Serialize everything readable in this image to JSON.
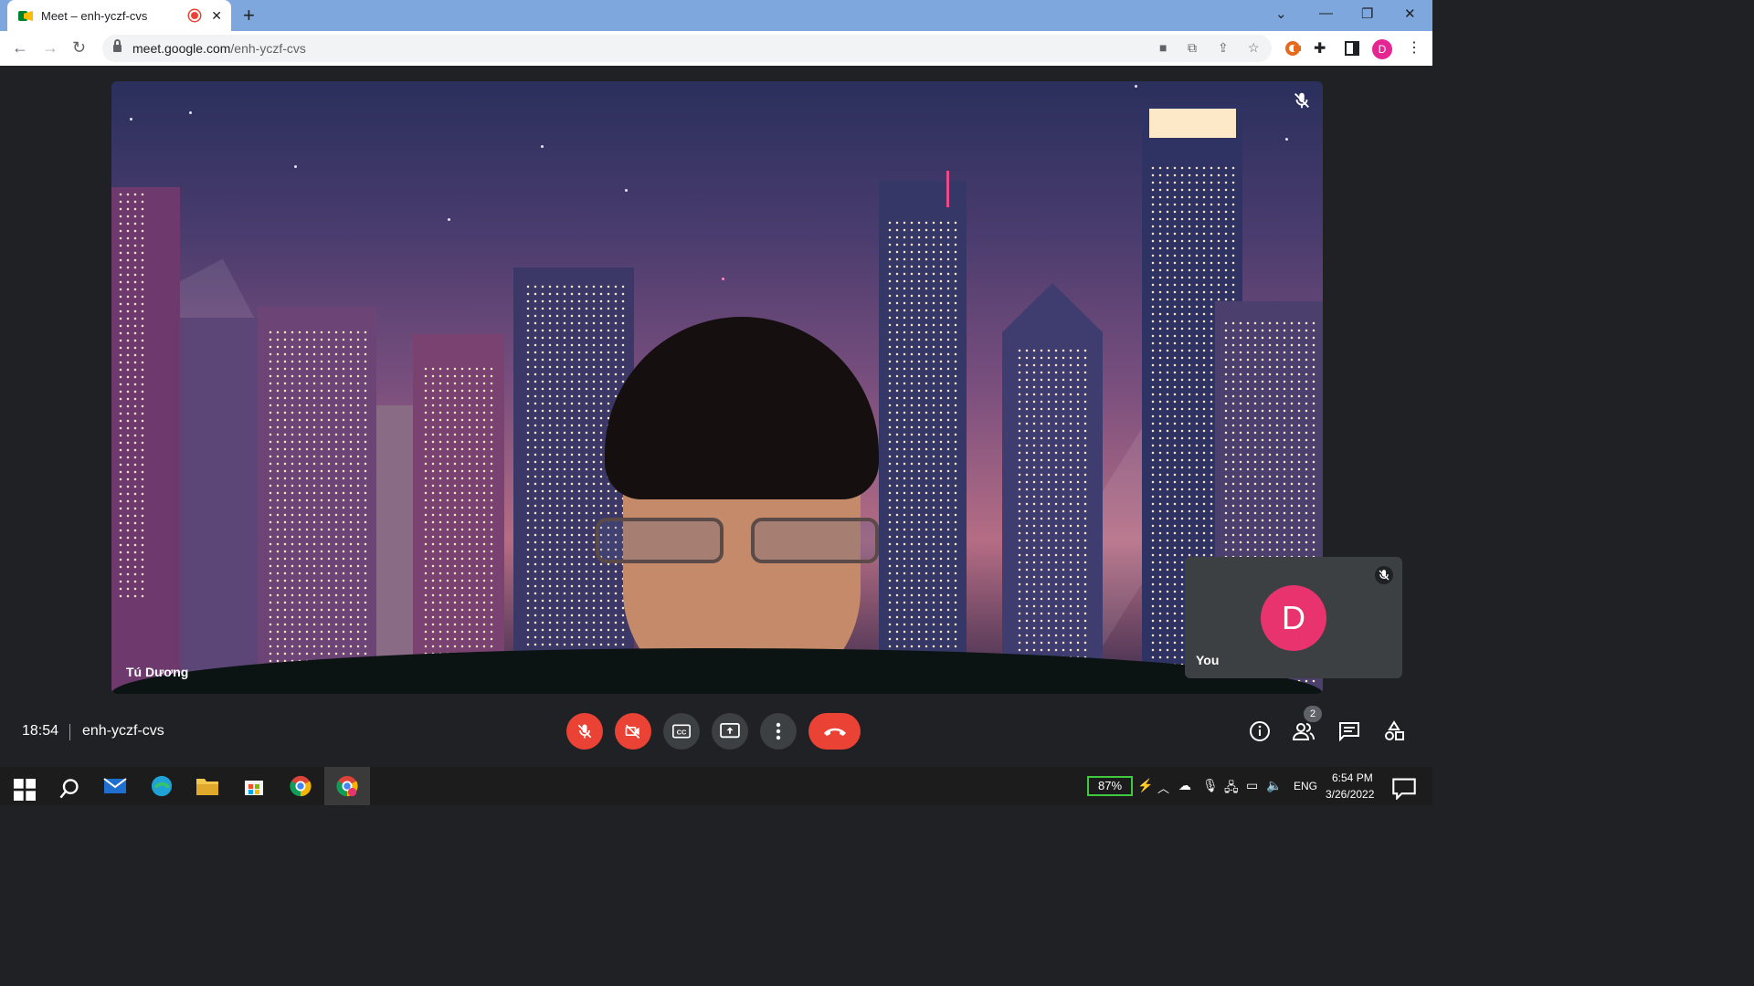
{
  "browser": {
    "tab_title": "Meet – enh-yczf-cvs",
    "url_domain": "meet.google.com",
    "url_path": "/enh-yczf-cvs",
    "profile_initial": "D"
  },
  "meeting": {
    "presenter_name": "Tú Dương",
    "self_label": "You",
    "self_initial": "D",
    "time": "18:54",
    "code": "enh-yczf-cvs",
    "participant_count": "2"
  },
  "colors": {
    "end_call": "#ea4335",
    "avatar": "#e8336e",
    "titlebar": "#7da7dd"
  },
  "taskbar": {
    "battery": "87%",
    "language": "ENG",
    "clock_time": "6:54 PM",
    "clock_date": "3/26/2022"
  }
}
